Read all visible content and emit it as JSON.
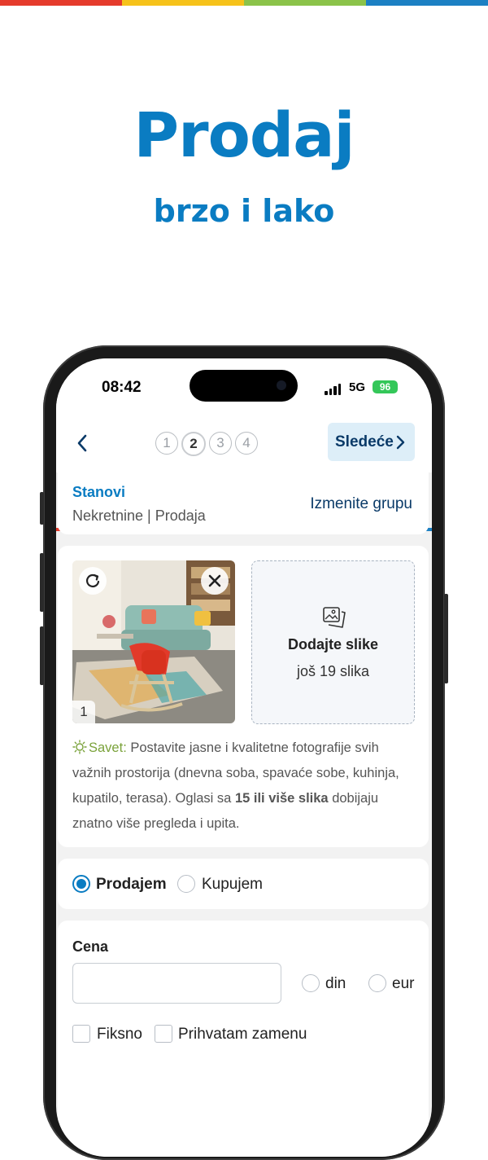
{
  "brand_colors": [
    "#e53b2c",
    "#f6c21a",
    "#8bc34a",
    "#1c80c3"
  ],
  "hero": {
    "title": "Prodaj",
    "subtitle": "brzo i lako"
  },
  "status_bar": {
    "time": "08:42",
    "network": "5G",
    "battery": "96"
  },
  "nav": {
    "steps": [
      "1",
      "2",
      "3",
      "4"
    ],
    "active_step": 2,
    "next_label": "Sledeće"
  },
  "category": {
    "title": "Stanovi",
    "path": "Nekretnine | Prodaja",
    "change_label": "Izmenite grupu"
  },
  "photos": {
    "photo_number": "1",
    "add_title": "Dodajte slike",
    "add_subtitle": "još 19 slika",
    "tip_label": "Savet:",
    "tip_text": " Postavite jasne i kvalitetne fotografije svih važnih prostorija (dnevna soba, spavaće sobe, kuhinja, kupatilo, terasa). Oglasi sa ",
    "tip_bold": "15 ili više slika",
    "tip_end": " dobijaju znatno više pregleda i upita."
  },
  "ad_type": {
    "option_sell": "Prodajem",
    "option_buy": "Kupujem",
    "selected": "Prodajem"
  },
  "price": {
    "label": "Cena",
    "value": "",
    "currency_din": "din",
    "currency_eur": "eur",
    "fixed_label": "Fiksno",
    "exchange_label": "Prihvatam zamenu"
  }
}
